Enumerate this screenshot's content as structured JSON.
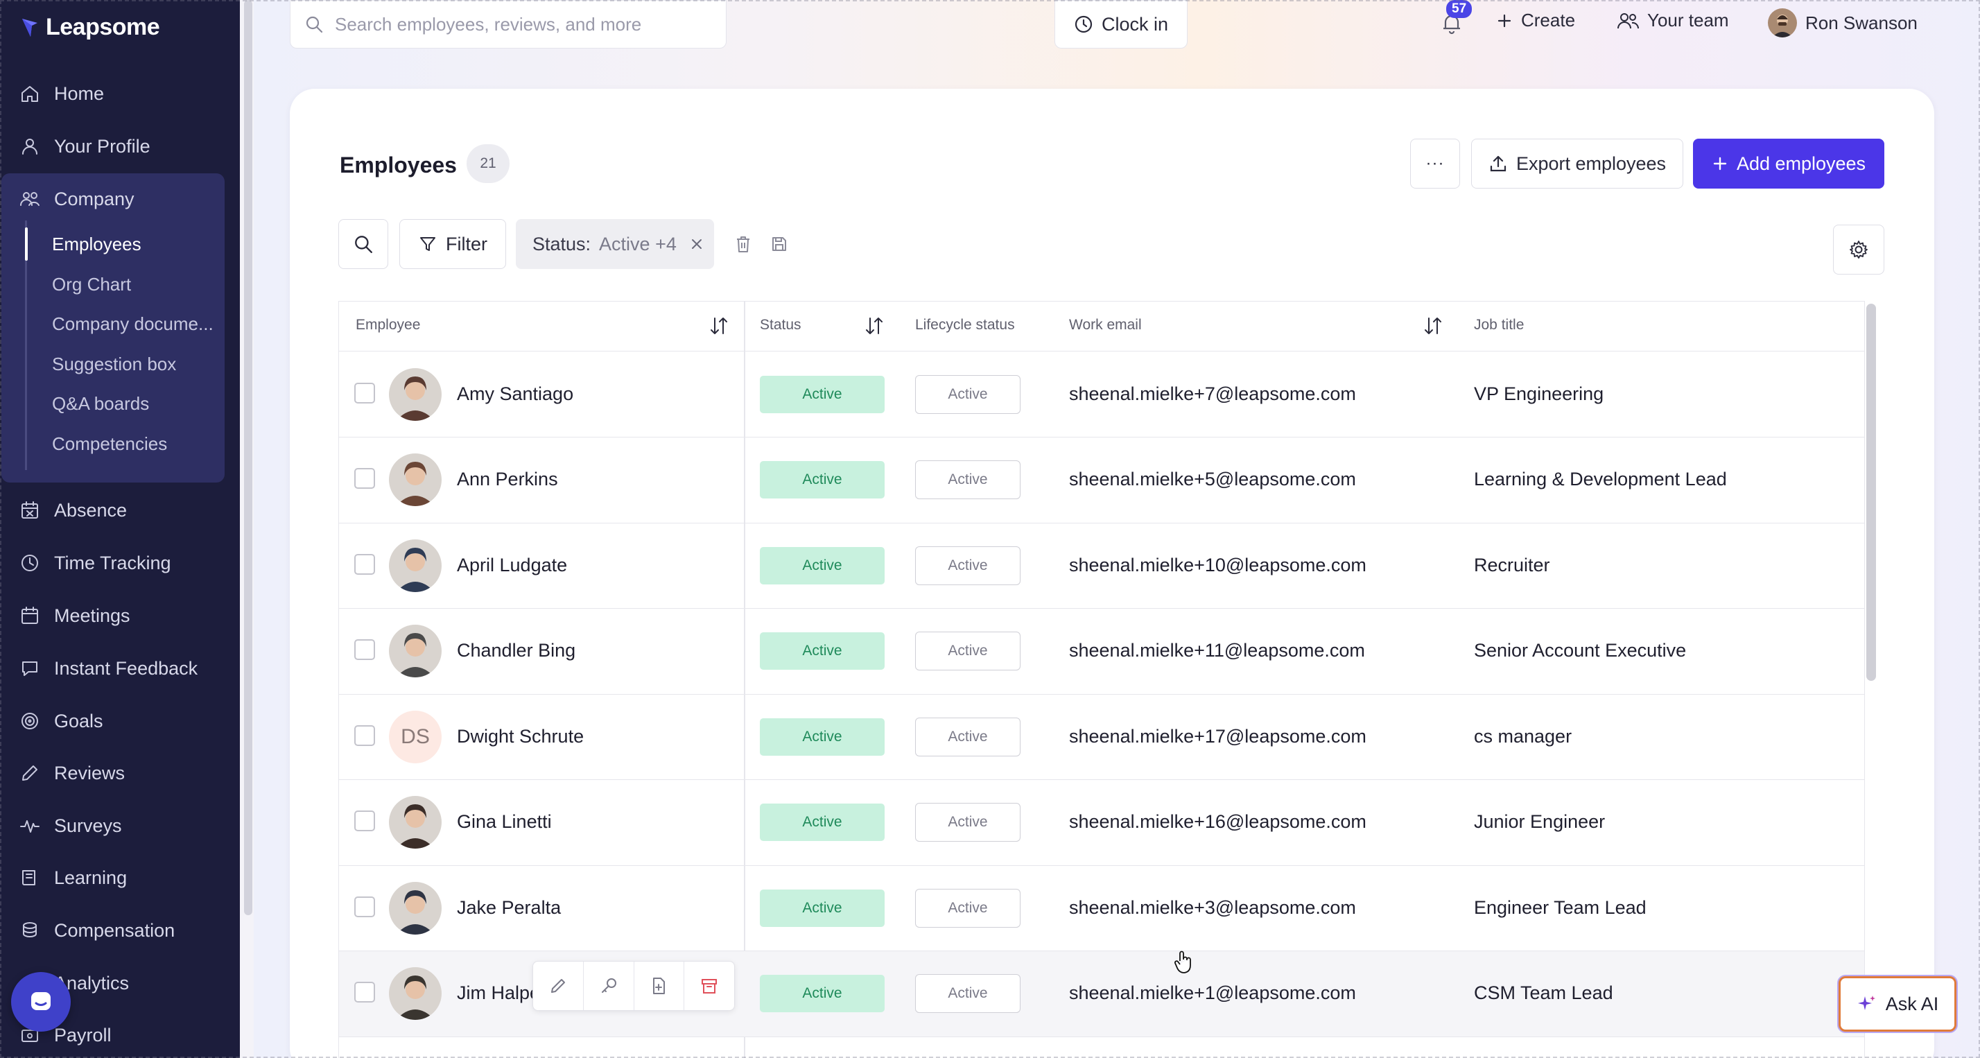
{
  "brand": {
    "name": "Leapsome"
  },
  "sidebar": {
    "items": [
      {
        "label": "Home",
        "icon": "home-icon"
      },
      {
        "label": "Your Profile",
        "icon": "user-icon"
      },
      {
        "label": "Company",
        "icon": "company-icon"
      },
      {
        "label": "Absence",
        "icon": "calendar-x-icon"
      },
      {
        "label": "Time Tracking",
        "icon": "clock-icon"
      },
      {
        "label": "Meetings",
        "icon": "calendar-icon"
      },
      {
        "label": "Instant Feedback",
        "icon": "chat-icon"
      },
      {
        "label": "Goals",
        "icon": "target-icon"
      },
      {
        "label": "Reviews",
        "icon": "pencil-icon"
      },
      {
        "label": "Surveys",
        "icon": "pulse-icon"
      },
      {
        "label": "Learning",
        "icon": "book-icon"
      },
      {
        "label": "Compensation",
        "icon": "coins-icon"
      },
      {
        "label": "Analytics",
        "icon": "chart-icon"
      },
      {
        "label": "Payroll",
        "icon": "payroll-icon"
      }
    ],
    "company_sub": [
      {
        "label": "Employees",
        "active": true
      },
      {
        "label": "Org Chart"
      },
      {
        "label": "Company docume..."
      },
      {
        "label": "Suggestion box"
      },
      {
        "label": "Q&A boards"
      },
      {
        "label": "Competencies"
      }
    ]
  },
  "topbar": {
    "search_placeholder": "Search employees, reviews, and more",
    "clock_in": "Clock in",
    "notifications_count": "57",
    "create": "Create",
    "your_team": "Your team",
    "user_name": "Ron Swanson"
  },
  "page": {
    "title": "Employees",
    "count": "21",
    "more": "···",
    "export": "Export employees",
    "add": "Add employees",
    "filter": "Filter",
    "status_filter_key": "Status:",
    "status_filter_value": "Active +4"
  },
  "table": {
    "headers": {
      "employee": "Employee",
      "status": "Status",
      "lifecycle": "Lifecycle status",
      "email": "Work email",
      "job": "Job title"
    },
    "rows": [
      {
        "name": "Amy Santiago",
        "status": "Active",
        "lifecycle": "Active",
        "email": "sheenal.mielke+7@leapsome.com",
        "job": "VP Engineering",
        "avatar": "photo",
        "tone": "#5a3b32"
      },
      {
        "name": "Ann Perkins",
        "status": "Active",
        "lifecycle": "Active",
        "email": "sheenal.mielke+5@leapsome.com",
        "job": "Learning & Development Lead",
        "avatar": "photo",
        "tone": "#6b4636"
      },
      {
        "name": "April Ludgate",
        "status": "Active",
        "lifecycle": "Active",
        "email": "sheenal.mielke+10@leapsome.com",
        "job": "Recruiter",
        "avatar": "photo",
        "tone": "#2f3c55"
      },
      {
        "name": "Chandler Bing",
        "status": "Active",
        "lifecycle": "Active",
        "email": "sheenal.mielke+11@leapsome.com",
        "job": "Senior Account Executive",
        "avatar": "photo",
        "tone": "#4a4a4a"
      },
      {
        "name": "Dwight Schrute",
        "status": "Active",
        "lifecycle": "Active",
        "email": "sheenal.mielke+17@leapsome.com",
        "job": "cs manager",
        "avatar": "initials",
        "initials": "DS"
      },
      {
        "name": "Gina Linetti",
        "status": "Active",
        "lifecycle": "Active",
        "email": "sheenal.mielke+16@leapsome.com",
        "job": "Junior Engineer",
        "avatar": "photo",
        "tone": "#3b2d28"
      },
      {
        "name": "Jake Peralta",
        "status": "Active",
        "lifecycle": "Active",
        "email": "sheenal.mielke+3@leapsome.com",
        "job": "Engineer Team Lead",
        "avatar": "photo",
        "tone": "#2e3444"
      },
      {
        "name": "Jim Halpe",
        "status": "Active",
        "lifecycle": "Active",
        "email": "sheenal.mielke+1@leapsome.com",
        "job": "CSM Team Lead",
        "avatar": "photo",
        "tone": "#3a3530"
      }
    ]
  },
  "ask_ai": "Ask AI",
  "colors": {
    "primary": "#4b36e8",
    "sidebar": "#1c1d3c",
    "status_bg": "#c8f1de",
    "status_text": "#1f8a5a"
  }
}
